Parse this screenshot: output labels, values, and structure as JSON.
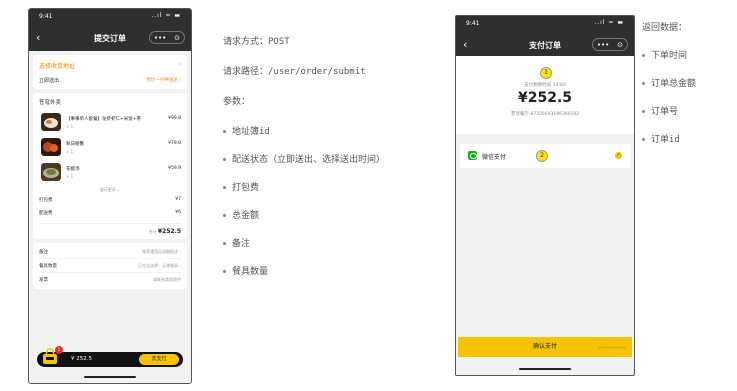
{
  "phone1": {
    "status": {
      "time": "9:41",
      "signal": "..ıl ≈ ▬"
    },
    "nav": {
      "back": "‹",
      "title": "提交订单",
      "capsule_dots": "•••",
      "capsule_target": "⊙"
    },
    "address": {
      "title": "选择收货地址",
      "chevron": "›",
      "send_label": "立即送出",
      "send_value": "预计一分钟送达 ›"
    },
    "shop": {
      "name": "苍穹外卖",
      "items": [
        {
          "name": "【事事单人套餐】龙虾虾仁+米饭+茶",
          "qty": "× 1",
          "price": "¥99.8"
        },
        {
          "name": "秋日螃蟹",
          "qty": "× 1",
          "price": "¥79.8"
        },
        {
          "name": "花椒汤",
          "qty": "× 1",
          "price": "¥59.9"
        }
      ],
      "more": "展开更多 ⌄",
      "fees": [
        {
          "label": "打包费",
          "value": "¥7"
        },
        {
          "label": "配送费",
          "value": "¥6"
        }
      ],
      "total_label": "合计",
      "total_value": "¥252.5"
    },
    "options": [
      {
        "label": "备注",
        "value": "推荐使用无接触配送 ›"
      },
      {
        "label": "餐具数量",
        "value": "已在店选择：无需餐具 ›"
      },
      {
        "label": "发票",
        "value": "请联系商家提供"
      }
    ],
    "cart": {
      "badge": "1",
      "price": "¥ 252.5",
      "pay_label": "去支付"
    }
  },
  "description": {
    "method": "请求方式：POST",
    "path": "请求路径：/user/order/submit",
    "params_label": "参数：",
    "params": [
      "地址簿id",
      "配送状态（立即送出、选择送出时间）",
      "打包费",
      "总金额",
      "备注",
      "餐具数量"
    ]
  },
  "phone2": {
    "status": {
      "time": "9:41",
      "signal": "..ıl ≈ ▬"
    },
    "nav": {
      "back": "‹",
      "title": "支付订单",
      "capsule_dots": "•••",
      "capsule_target": "⊙"
    },
    "badge1": "1",
    "badge2": "2",
    "remain": "支付剩余时间 14:60",
    "amount": "¥252.5",
    "shop": "苍穹餐厅-67335643186360192",
    "method_label": "微信支付",
    "confirm_label": "确认支付"
  },
  "return_data": {
    "title": "返回数据：",
    "items": [
      "下单时间",
      "订单总金额",
      "订单号",
      "订单id"
    ]
  },
  "colors": {
    "accent": "#f5c300",
    "orange": "#f28c00",
    "wechat": "#1aad19",
    "header": "#2f2f2f"
  }
}
